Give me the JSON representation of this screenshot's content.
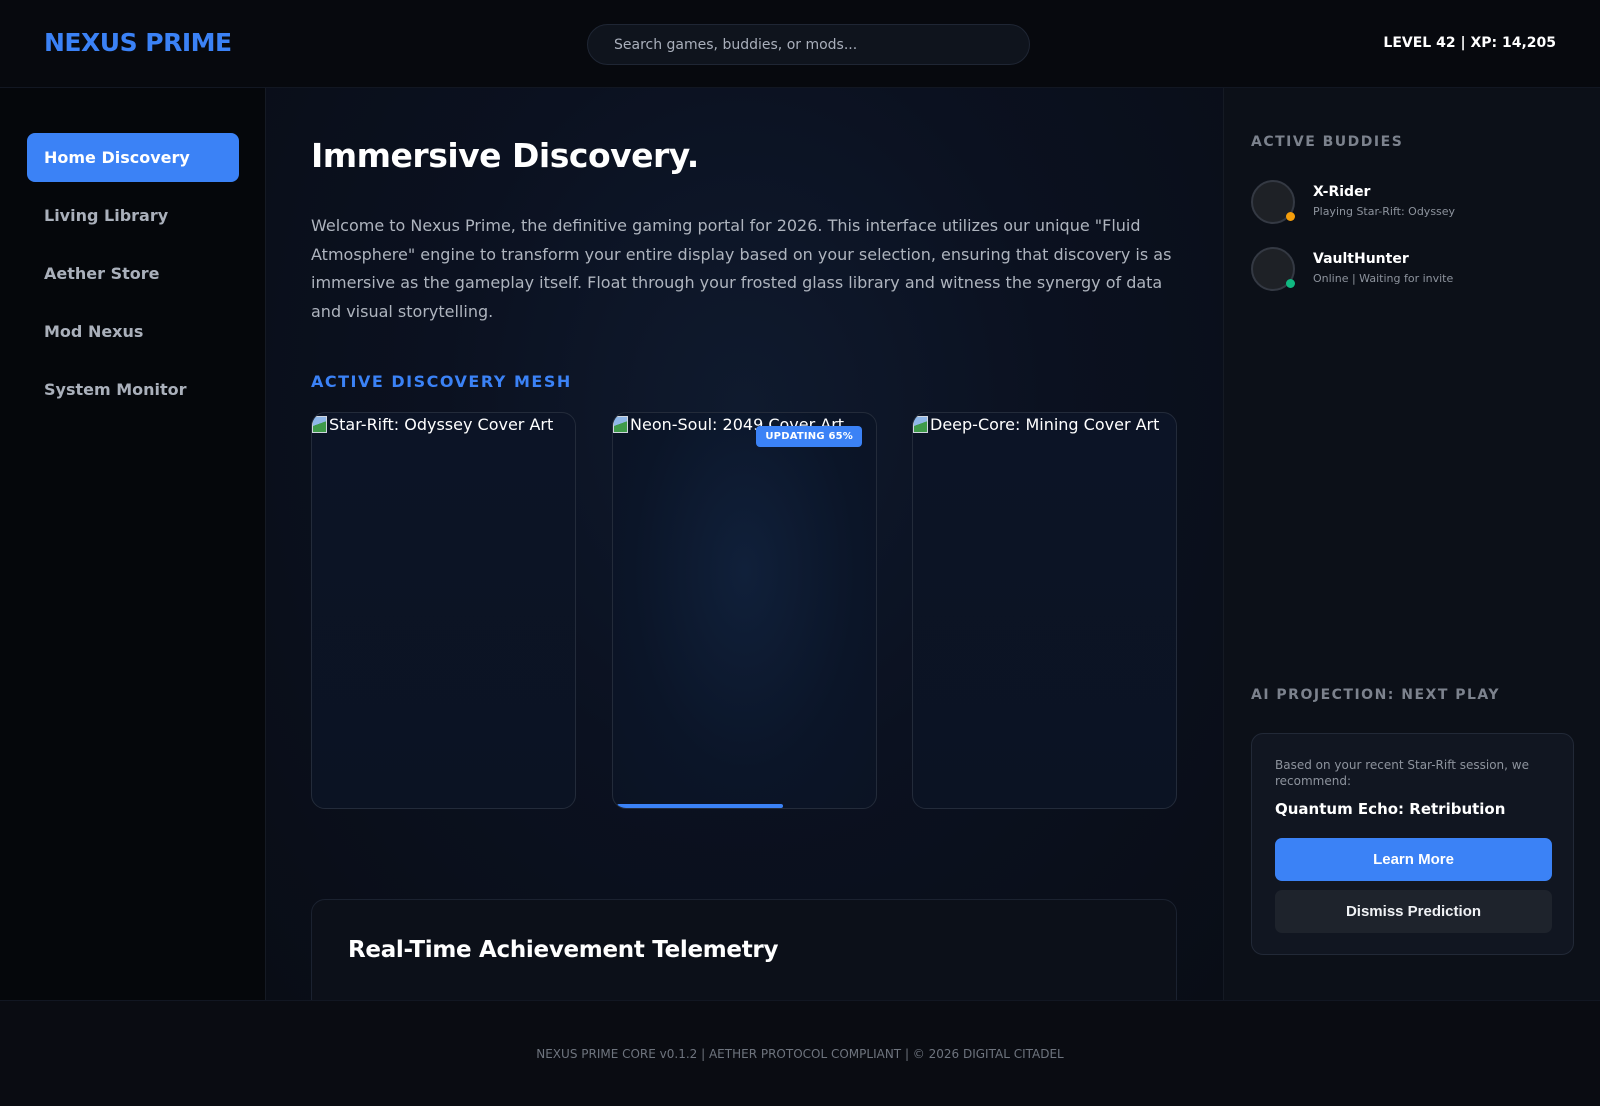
{
  "header": {
    "logo": "NEXUS PRIME",
    "search_placeholder": "Search games, buddies, or mods...",
    "level_xp": "LEVEL 42 | XP: 14,205"
  },
  "sidebar": {
    "items": [
      {
        "label": "Home Discovery",
        "active": true
      },
      {
        "label": "Living Library",
        "active": false
      },
      {
        "label": "Aether Store",
        "active": false
      },
      {
        "label": "Mod Nexus",
        "active": false
      },
      {
        "label": "System Monitor",
        "active": false
      }
    ]
  },
  "main": {
    "title": "Immersive Discovery.",
    "intro": "Welcome to Nexus Prime, the definitive gaming portal for 2026. This interface utilizes our unique \"Fluid Atmosphere\" engine to transform your entire display based on your selection, ensuring that discovery is as immersive as the gameplay itself. Float through your frosted glass library and witness the synergy of data and visual storytelling.",
    "mesh_label": "ACTIVE DISCOVERY MESH",
    "cards": [
      {
        "alt": "Star-Rift: Odyssey Cover Art"
      },
      {
        "alt": "Neon-Soul: 2049 Cover Art",
        "badge": "UPDATING 65%",
        "progress": 0.65
      },
      {
        "alt": "Deep-Core: Mining Cover Art"
      }
    ],
    "telemetry_title": "Real-Time Achievement Telemetry"
  },
  "right_panel": {
    "buddies_label": "ACTIVE BUDDIES",
    "buddies": [
      {
        "name": "X-Rider",
        "status": "Playing Star-Rift: Odyssey",
        "status_color": "#f59e0b"
      },
      {
        "name": "VaultHunter",
        "status": "Online | Waiting for invite",
        "status_color": "#10b981"
      }
    ],
    "ai_label": "AI PROJECTION: NEXT PLAY",
    "ai_text": "Based on your recent Star-Rift session, we recommend:",
    "ai_game": "Quantum Echo: Retribution",
    "learn_more": "Learn More",
    "dismiss": "Dismiss Prediction"
  },
  "footer": {
    "text": "NEXUS PRIME CORE v0.1.2 | AETHER PROTOCOL COMPLIANT | © 2026 DIGITAL CITADEL"
  },
  "colors": {
    "accent": "#3b82f6",
    "background": "#0a0d14"
  }
}
